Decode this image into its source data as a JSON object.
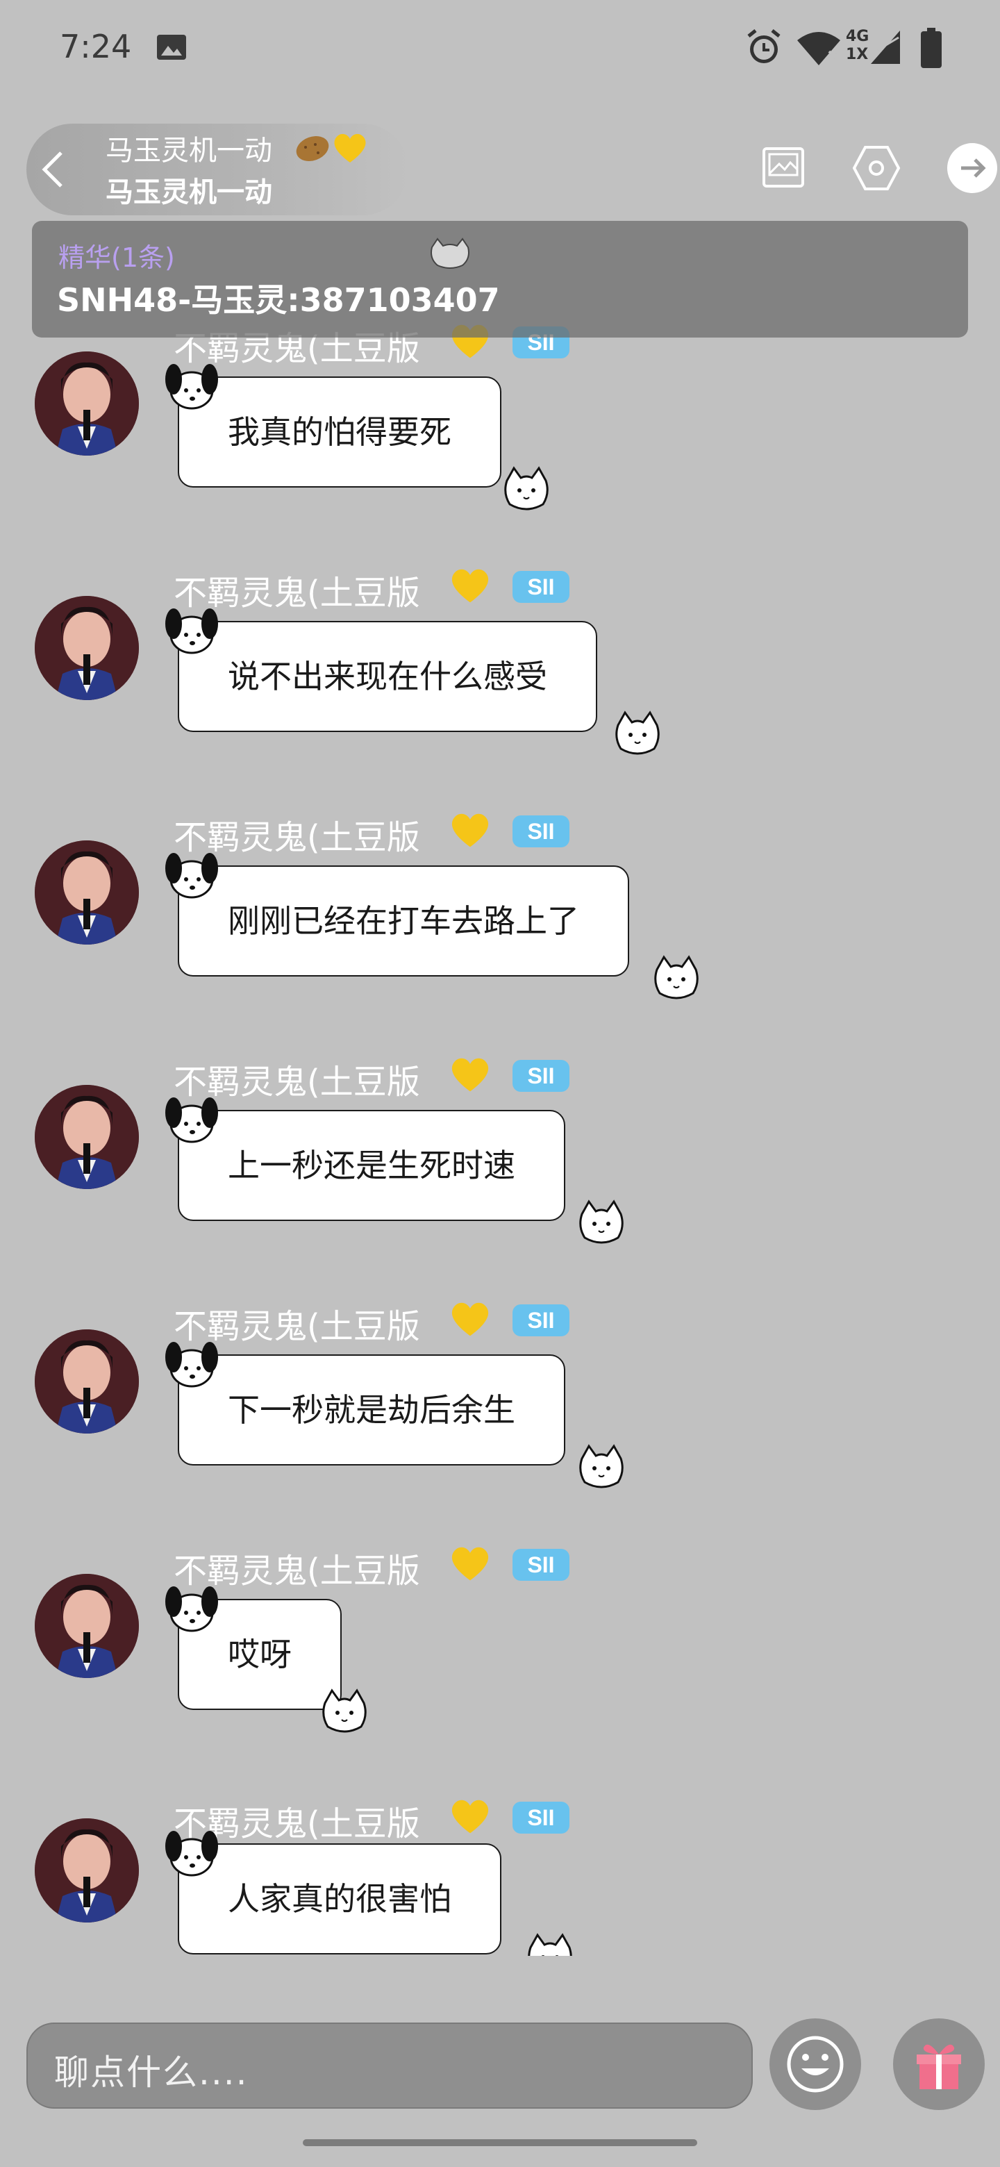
{
  "status_bar": {
    "time": "7:24",
    "network_top": "4G",
    "network_bottom": "1X"
  },
  "header": {
    "room_name": "马玉灵机一动",
    "room_subtitle": "马玉灵机一动",
    "icons": [
      "back-icon",
      "potato-icon",
      "yellow-heart-icon",
      "photo-icon",
      "settings-icon",
      "share-arrow-icon"
    ]
  },
  "pinned": {
    "label": "精华(1条)",
    "text": "SNH48-马玉灵:387103407"
  },
  "messages": [
    {
      "sender": "不羁灵鬼(土豆版",
      "badge": "SII",
      "text": "我真的怕得要死"
    },
    {
      "sender": "不羁灵鬼(土豆版",
      "badge": "SII",
      "text": "说不出来现在什么感受"
    },
    {
      "sender": "不羁灵鬼(土豆版",
      "badge": "SII",
      "text": "刚刚已经在打车去路上了"
    },
    {
      "sender": "不羁灵鬼(土豆版",
      "badge": "SII",
      "text": "上一秒还是生死时速"
    },
    {
      "sender": "不羁灵鬼(土豆版",
      "badge": "SII",
      "text": "下一秒就是劫后余生"
    },
    {
      "sender": "不羁灵鬼(土豆版",
      "badge": "SII",
      "text": "哎呀"
    },
    {
      "sender": "不羁灵鬼(土豆版",
      "badge": "SII",
      "text": "人家真的很害怕"
    }
  ],
  "input": {
    "placeholder": "聊点什么...."
  },
  "colors": {
    "background": "#c1c1c1",
    "badge": "#68c2ee",
    "pinned_label": "#b9a0f0",
    "heart": "#f5c518"
  }
}
